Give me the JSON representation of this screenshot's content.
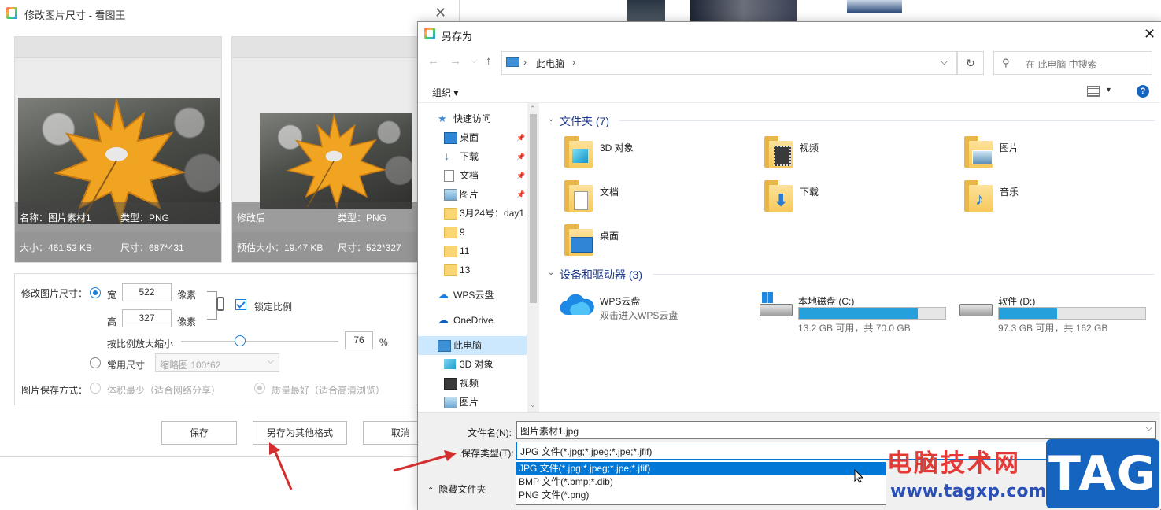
{
  "resize_window": {
    "title": "修改图片尺寸 - 看图王",
    "left_preview": {
      "name": "名称：图片素材1",
      "type": "类型：PNG",
      "size": "大小：461.52 KB",
      "dimensions": "尺寸：687*431"
    },
    "right_preview": {
      "name": "修改后",
      "type": "类型：PNG",
      "size": "预估大小：19.47 KB",
      "dimensions": "尺寸：522*327"
    },
    "form": {
      "resize_label": "修改图片尺寸：",
      "width_label": "宽",
      "width_value": "522",
      "height_label": "高",
      "height_value": "327",
      "unit_pixel": "像素",
      "lock_ratio_label": "锁定比例",
      "scale_label": "按比例放大缩小",
      "scale_value": "76",
      "scale_unit": "%",
      "scale_fraction": 0.37,
      "common_size_label": "常用尺寸",
      "common_size_value": "缩略图 100*62",
      "save_mode_label": "图片保存方式：",
      "mode_small": "体积最少（适合网络分享）",
      "mode_quality": "质量最好（适合高清浏览）"
    },
    "buttons": {
      "save": "保存",
      "save_as_other": "另存为其他格式",
      "cancel": "取消"
    }
  },
  "save_dialog": {
    "title": "另存为",
    "address": {
      "path_root": "此电脑",
      "separator": "›",
      "search_placeholder": "在 此电脑 中搜索"
    },
    "toolbar": {
      "organize": "组织 ▾"
    },
    "nav": [
      {
        "label": "快速访问",
        "icon": "star-icon",
        "indent": 0,
        "pinned": false
      },
      {
        "label": "桌面",
        "icon": "desktop-icon",
        "indent": 1,
        "pinned": true
      },
      {
        "label": "下载",
        "icon": "download-icon",
        "indent": 1,
        "pinned": true
      },
      {
        "label": "文档",
        "icon": "document-icon",
        "indent": 1,
        "pinned": true
      },
      {
        "label": "图片",
        "icon": "picture-icon",
        "indent": 1,
        "pinned": true
      },
      {
        "label": "3月24号：day1",
        "icon": "folder-icon",
        "indent": 1,
        "pinned": false
      },
      {
        "label": "9",
        "icon": "folder-icon",
        "indent": 1,
        "pinned": false
      },
      {
        "label": "11",
        "icon": "folder-icon",
        "indent": 1,
        "pinned": false
      },
      {
        "label": "13",
        "icon": "folder-icon",
        "indent": 1,
        "pinned": false
      },
      {
        "label": "WPS云盘",
        "icon": "cloud-icon",
        "indent": 0,
        "pinned": false
      },
      {
        "label": "OneDrive",
        "icon": "onedrive-icon",
        "indent": 0,
        "pinned": false
      },
      {
        "label": "此电脑",
        "icon": "computer-icon",
        "indent": 0,
        "pinned": false,
        "selected": true
      },
      {
        "label": "3D 对象",
        "icon": "cube-icon",
        "indent": 1,
        "pinned": false
      },
      {
        "label": "视频",
        "icon": "video-icon",
        "indent": 1,
        "pinned": false
      },
      {
        "label": "图片",
        "icon": "picture-icon",
        "indent": 1,
        "pinned": false
      }
    ],
    "folders_title": "文件夹 (7)",
    "folders": [
      {
        "label": "3D 对象",
        "badge": "cube"
      },
      {
        "label": "视频",
        "badge": "film"
      },
      {
        "label": "图片",
        "badge": "picture"
      },
      {
        "label": "文档",
        "badge": "doc"
      },
      {
        "label": "下载",
        "badge": "arrow"
      },
      {
        "label": "音乐",
        "badge": "music"
      },
      {
        "label": "桌面",
        "badge": "desktop"
      }
    ],
    "devices_title": "设备和驱动器 (3)",
    "devices": [
      {
        "label": "WPS云盘",
        "sub": "双击进入WPS云盘",
        "type": "cloud"
      },
      {
        "label": "本地磁盘 (C:)",
        "sub": "13.2 GB 可用，共 70.0 GB",
        "type": "drive",
        "used_fraction": 0.81,
        "windows": true
      },
      {
        "label": "软件 (D:)",
        "sub": "97.3 GB 可用，共 162 GB",
        "type": "drive",
        "used_fraction": 0.4,
        "windows": false
      }
    ],
    "filename_label": "文件名(N):",
    "filename_value": "图片素材1.jpg",
    "filetype_label": "保存类型(T):",
    "filetype_value": "JPG 文件(*.jpg;*.jpeg;*.jpe;*.jfif)",
    "filetype_options": [
      "JPG 文件(*.jpg;*.jpeg;*.jpe;*.jfif)",
      "BMP 文件(*.bmp;*.dib)",
      "PNG 文件(*.png)"
    ],
    "hide_folders": "隐藏文件夹",
    "colors": {
      "accent": "#0078d7",
      "drive_bar": "#26a0da"
    }
  },
  "watermark": {
    "site_name": "电脑技术网",
    "site_url": "www.tagxp.com",
    "logo": "TAG"
  }
}
